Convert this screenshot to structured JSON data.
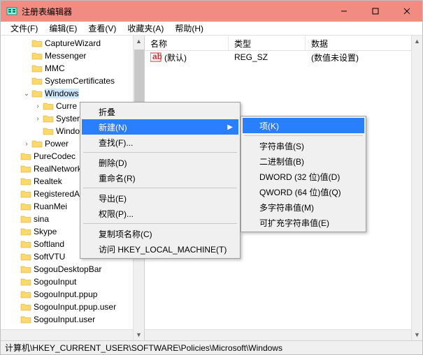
{
  "window": {
    "title": "注册表编辑器",
    "min": "–",
    "max": "□",
    "close": "×"
  },
  "menubar": {
    "file": "文件(F)",
    "edit": "编辑(E)",
    "view": "查看(V)",
    "favorites": "收藏夹(A)",
    "help": "帮助(H)"
  },
  "tree": {
    "items": [
      {
        "indent": 2,
        "label": "CaptureWizard"
      },
      {
        "indent": 2,
        "label": "Messenger"
      },
      {
        "indent": 2,
        "label": "MMC"
      },
      {
        "indent": 2,
        "label": "SystemCertificates"
      },
      {
        "indent": 2,
        "label": "Windows",
        "expanded": true,
        "selected": true
      },
      {
        "indent": 3,
        "label": "Curre",
        "expandable": true
      },
      {
        "indent": 3,
        "label": "Syster",
        "expandable": true
      },
      {
        "indent": 3,
        "label": "Windows"
      },
      {
        "indent": 2,
        "label": "Power",
        "expandable": true
      },
      {
        "indent": 1,
        "label": "PureCodec"
      },
      {
        "indent": 1,
        "label": "RealNetworks"
      },
      {
        "indent": 1,
        "label": "Realtek"
      },
      {
        "indent": 1,
        "label": "RegisteredAppl"
      },
      {
        "indent": 1,
        "label": "RuanMei"
      },
      {
        "indent": 1,
        "label": "sina"
      },
      {
        "indent": 1,
        "label": "Skype"
      },
      {
        "indent": 1,
        "label": "Softland"
      },
      {
        "indent": 1,
        "label": "SoftVTU"
      },
      {
        "indent": 1,
        "label": "SogouDesktopBar"
      },
      {
        "indent": 1,
        "label": "SogouInput"
      },
      {
        "indent": 1,
        "label": "SogouInput.ppup"
      },
      {
        "indent": 1,
        "label": "SogouInput.ppup.user"
      },
      {
        "indent": 1,
        "label": "SogouInput.user"
      }
    ]
  },
  "list": {
    "headers": {
      "name": "名称",
      "type": "类型",
      "data": "数据"
    },
    "rows": [
      {
        "name": "(默认)",
        "type": "REG_SZ",
        "data": "(数值未设置)"
      }
    ]
  },
  "ctx1": {
    "collapse": "折叠",
    "new": "新建(N)",
    "find": "查找(F)...",
    "delete": "删除(D)",
    "rename": "重命名(R)",
    "export": "导出(E)",
    "permissions": "权限(P)...",
    "copykey": "复制项名称(C)",
    "goto": "访问 HKEY_LOCAL_MACHINE(T)"
  },
  "ctx2": {
    "key": "项(K)",
    "string": "字符串值(S)",
    "binary": "二进制值(B)",
    "dword": "DWORD (32 位)值(D)",
    "qword": "QWORD (64 位)值(Q)",
    "multi": "多字符串值(M)",
    "expand": "可扩充字符串值(E)"
  },
  "status": "计算机\\HKEY_CURRENT_USER\\SOFTWARE\\Policies\\Microsoft\\Windows"
}
